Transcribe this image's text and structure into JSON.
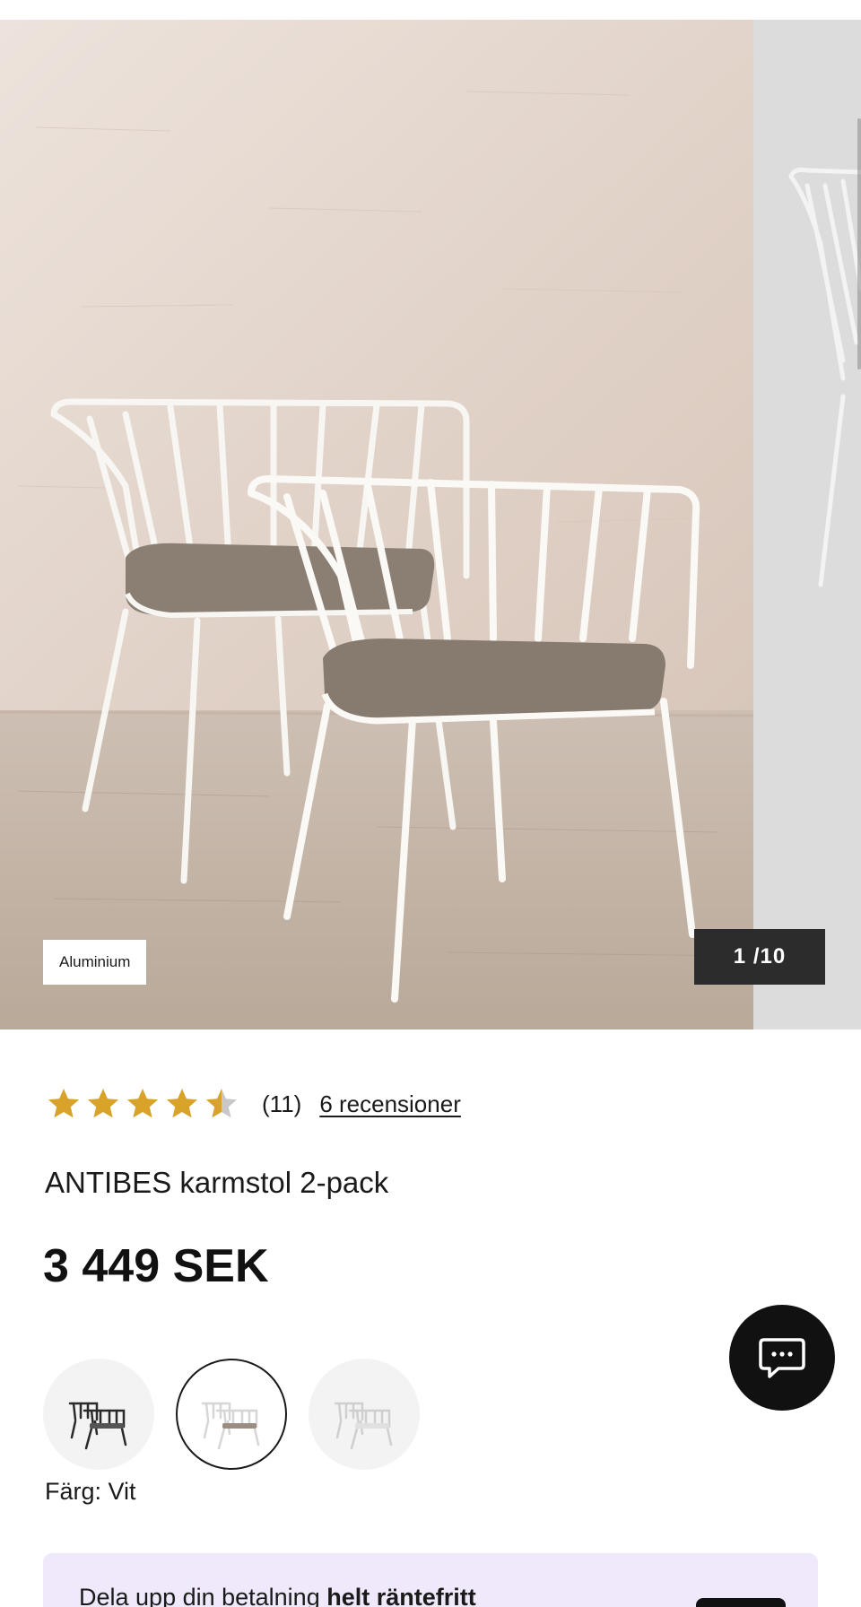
{
  "gallery": {
    "material_badge": "Aluminium",
    "counter": "1 /10"
  },
  "product": {
    "rating": 4.5,
    "rating_max": 5,
    "rating_count": "(11)",
    "reviews_link": "6 recensioner",
    "title": "ANTIBES karmstol 2-pack",
    "price": "3 449 SEK",
    "color_label": "Färg: Vit",
    "swatches": [
      {
        "name": "black"
      },
      {
        "name": "white",
        "selected": true
      },
      {
        "name": "white-grey"
      }
    ]
  },
  "payment": {
    "text_regular": "Dela upp din betalning ",
    "text_bold": "helt räntefritt"
  },
  "colors": {
    "star": "#D9A32A",
    "star_empty": "#C8C8C8",
    "price": "#111111",
    "chat_button": "#111111",
    "counter_bg": "#2C2C2C",
    "klarna_bg": "#EFE9FB"
  },
  "icons": {
    "chat": "chat-bubble-icon",
    "star": "star-icon"
  }
}
